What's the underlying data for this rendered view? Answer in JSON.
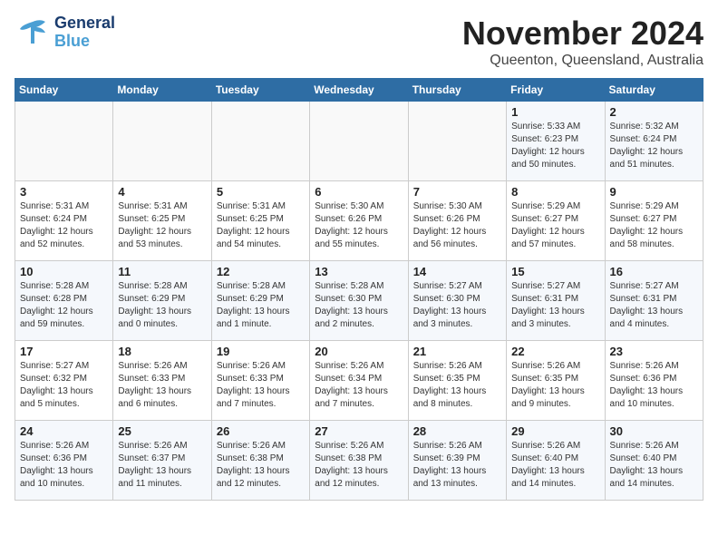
{
  "header": {
    "logo_general": "General",
    "logo_blue": "Blue",
    "month_title": "November 2024",
    "location": "Queenton, Queensland, Australia"
  },
  "weekdays": [
    "Sunday",
    "Monday",
    "Tuesday",
    "Wednesday",
    "Thursday",
    "Friday",
    "Saturday"
  ],
  "weeks": [
    [
      {
        "day": "",
        "info": ""
      },
      {
        "day": "",
        "info": ""
      },
      {
        "day": "",
        "info": ""
      },
      {
        "day": "",
        "info": ""
      },
      {
        "day": "",
        "info": ""
      },
      {
        "day": "1",
        "info": "Sunrise: 5:33 AM\nSunset: 6:23 PM\nDaylight: 12 hours\nand 50 minutes."
      },
      {
        "day": "2",
        "info": "Sunrise: 5:32 AM\nSunset: 6:24 PM\nDaylight: 12 hours\nand 51 minutes."
      }
    ],
    [
      {
        "day": "3",
        "info": "Sunrise: 5:31 AM\nSunset: 6:24 PM\nDaylight: 12 hours\nand 52 minutes."
      },
      {
        "day": "4",
        "info": "Sunrise: 5:31 AM\nSunset: 6:25 PM\nDaylight: 12 hours\nand 53 minutes."
      },
      {
        "day": "5",
        "info": "Sunrise: 5:31 AM\nSunset: 6:25 PM\nDaylight: 12 hours\nand 54 minutes."
      },
      {
        "day": "6",
        "info": "Sunrise: 5:30 AM\nSunset: 6:26 PM\nDaylight: 12 hours\nand 55 minutes."
      },
      {
        "day": "7",
        "info": "Sunrise: 5:30 AM\nSunset: 6:26 PM\nDaylight: 12 hours\nand 56 minutes."
      },
      {
        "day": "8",
        "info": "Sunrise: 5:29 AM\nSunset: 6:27 PM\nDaylight: 12 hours\nand 57 minutes."
      },
      {
        "day": "9",
        "info": "Sunrise: 5:29 AM\nSunset: 6:27 PM\nDaylight: 12 hours\nand 58 minutes."
      }
    ],
    [
      {
        "day": "10",
        "info": "Sunrise: 5:28 AM\nSunset: 6:28 PM\nDaylight: 12 hours\nand 59 minutes."
      },
      {
        "day": "11",
        "info": "Sunrise: 5:28 AM\nSunset: 6:29 PM\nDaylight: 13 hours\nand 0 minutes."
      },
      {
        "day": "12",
        "info": "Sunrise: 5:28 AM\nSunset: 6:29 PM\nDaylight: 13 hours\nand 1 minute."
      },
      {
        "day": "13",
        "info": "Sunrise: 5:28 AM\nSunset: 6:30 PM\nDaylight: 13 hours\nand 2 minutes."
      },
      {
        "day": "14",
        "info": "Sunrise: 5:27 AM\nSunset: 6:30 PM\nDaylight: 13 hours\nand 3 minutes."
      },
      {
        "day": "15",
        "info": "Sunrise: 5:27 AM\nSunset: 6:31 PM\nDaylight: 13 hours\nand 3 minutes."
      },
      {
        "day": "16",
        "info": "Sunrise: 5:27 AM\nSunset: 6:31 PM\nDaylight: 13 hours\nand 4 minutes."
      }
    ],
    [
      {
        "day": "17",
        "info": "Sunrise: 5:27 AM\nSunset: 6:32 PM\nDaylight: 13 hours\nand 5 minutes."
      },
      {
        "day": "18",
        "info": "Sunrise: 5:26 AM\nSunset: 6:33 PM\nDaylight: 13 hours\nand 6 minutes."
      },
      {
        "day": "19",
        "info": "Sunrise: 5:26 AM\nSunset: 6:33 PM\nDaylight: 13 hours\nand 7 minutes."
      },
      {
        "day": "20",
        "info": "Sunrise: 5:26 AM\nSunset: 6:34 PM\nDaylight: 13 hours\nand 7 minutes."
      },
      {
        "day": "21",
        "info": "Sunrise: 5:26 AM\nSunset: 6:35 PM\nDaylight: 13 hours\nand 8 minutes."
      },
      {
        "day": "22",
        "info": "Sunrise: 5:26 AM\nSunset: 6:35 PM\nDaylight: 13 hours\nand 9 minutes."
      },
      {
        "day": "23",
        "info": "Sunrise: 5:26 AM\nSunset: 6:36 PM\nDaylight: 13 hours\nand 10 minutes."
      }
    ],
    [
      {
        "day": "24",
        "info": "Sunrise: 5:26 AM\nSunset: 6:36 PM\nDaylight: 13 hours\nand 10 minutes."
      },
      {
        "day": "25",
        "info": "Sunrise: 5:26 AM\nSunset: 6:37 PM\nDaylight: 13 hours\nand 11 minutes."
      },
      {
        "day": "26",
        "info": "Sunrise: 5:26 AM\nSunset: 6:38 PM\nDaylight: 13 hours\nand 12 minutes."
      },
      {
        "day": "27",
        "info": "Sunrise: 5:26 AM\nSunset: 6:38 PM\nDaylight: 13 hours\nand 12 minutes."
      },
      {
        "day": "28",
        "info": "Sunrise: 5:26 AM\nSunset: 6:39 PM\nDaylight: 13 hours\nand 13 minutes."
      },
      {
        "day": "29",
        "info": "Sunrise: 5:26 AM\nSunset: 6:40 PM\nDaylight: 13 hours\nand 14 minutes."
      },
      {
        "day": "30",
        "info": "Sunrise: 5:26 AM\nSunset: 6:40 PM\nDaylight: 13 hours\nand 14 minutes."
      }
    ]
  ]
}
